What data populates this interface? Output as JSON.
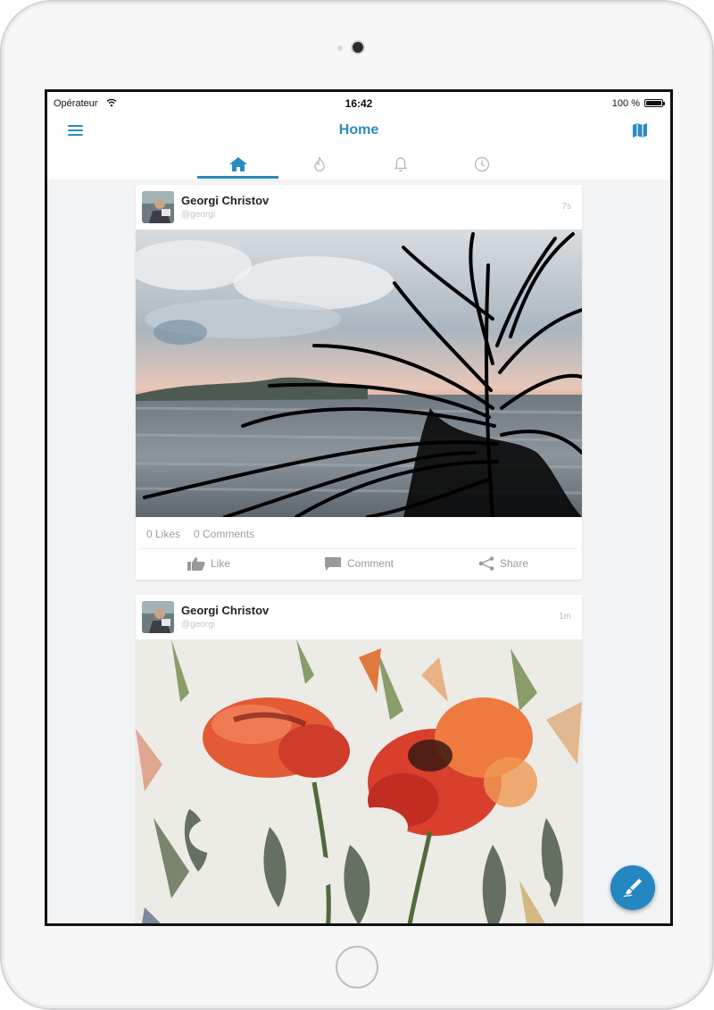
{
  "status_bar": {
    "carrier": "Opérateur",
    "time": "16:42",
    "battery": "100 %"
  },
  "nav": {
    "title": "Home",
    "menu_icon": "hamburger-menu-icon",
    "map_icon": "map-icon"
  },
  "tabs": [
    {
      "icon": "home-icon",
      "active": true
    },
    {
      "icon": "flame-icon",
      "active": false
    },
    {
      "icon": "bell-icon",
      "active": false
    },
    {
      "icon": "clock-icon",
      "active": false
    }
  ],
  "posts": [
    {
      "author": "Georgi Christov",
      "handle": "@georgi",
      "time": "7s",
      "likes": "0 Likes",
      "comments": "0 Comments",
      "actions": {
        "like": "Like",
        "comment": "Comment",
        "share": "Share"
      }
    },
    {
      "author": "Georgi Christov",
      "handle": "@georgi",
      "time": "1m"
    }
  ],
  "fab": {
    "icon": "brush-icon"
  },
  "colors": {
    "accent": "#2a8ac4",
    "fab": "#2487c2",
    "feed_bg": "#f2f3f5"
  }
}
